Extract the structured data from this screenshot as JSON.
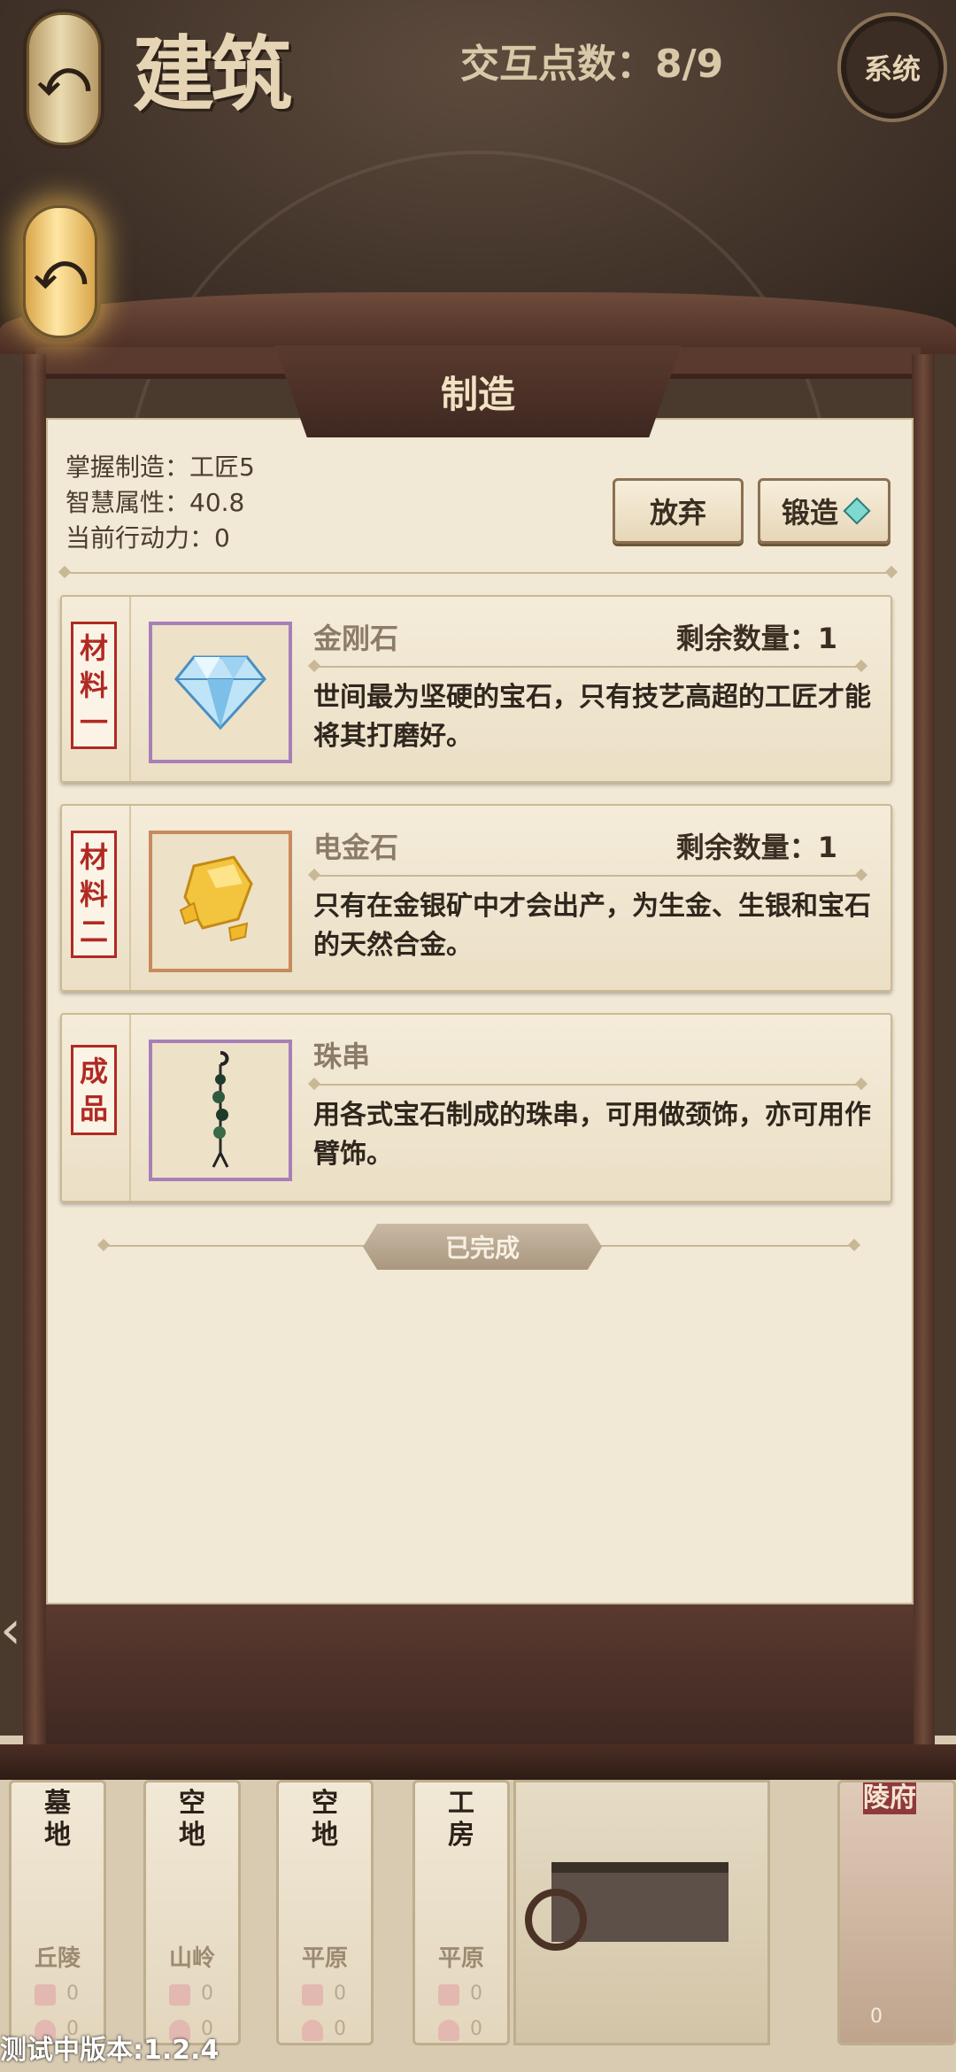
{
  "header": {
    "logo_text": "建筑",
    "action_points": "交互点数：8/9",
    "system_button": "系统"
  },
  "panel": {
    "title": "制造",
    "stats": [
      "掌握制造：工匠5",
      "智慧属性：40.8",
      "当前行动力：0"
    ],
    "abandon_label": "放弃",
    "forge_label": "锻造",
    "items": [
      {
        "tag": [
          "材",
          "料",
          "一"
        ],
        "name": "金刚石",
        "quantity": "剩余数量：1",
        "description": "世间最为坚硬的宝石，只有技艺高超的工匠才能将其打磨好。",
        "icon": "diamond-icon"
      },
      {
        "tag": [
          "材",
          "料",
          "二"
        ],
        "name": "电金石",
        "quantity": "剩余数量：1",
        "description": "只有在金银矿中才会出产，为生金、生银和宝石的天然合金。",
        "icon": "electrum-icon"
      },
      {
        "tag": [
          "成",
          "品"
        ],
        "name": "珠串",
        "quantity": "",
        "description": "用各式宝石制成的珠串，可用做颈饰，亦可用作臂饰。",
        "icon": "bead-string-icon"
      }
    ],
    "status": "已完成"
  },
  "map_tiles": [
    {
      "name": "墓地",
      "terrain": "丘陵",
      "count_a": "0",
      "count_b": "0"
    },
    {
      "name": "空地",
      "terrain": "山岭",
      "count_a": "0",
      "count_b": "0"
    },
    {
      "name": "空地",
      "terrain": "平原",
      "count_a": "0",
      "count_b": "0"
    },
    {
      "name": "工房",
      "terrain": "平原",
      "count_a": "0",
      "count_b": "0"
    }
  ],
  "right_tile": {
    "name": "陵府",
    "count": "0"
  },
  "version": "测试中版本:1.2.4",
  "colors": {
    "tag_red": "#b02a23",
    "material_slot_purple": "#a77fb8",
    "material_slot_orange": "#c98a5d",
    "gem_teal": "#7ed9d0"
  }
}
